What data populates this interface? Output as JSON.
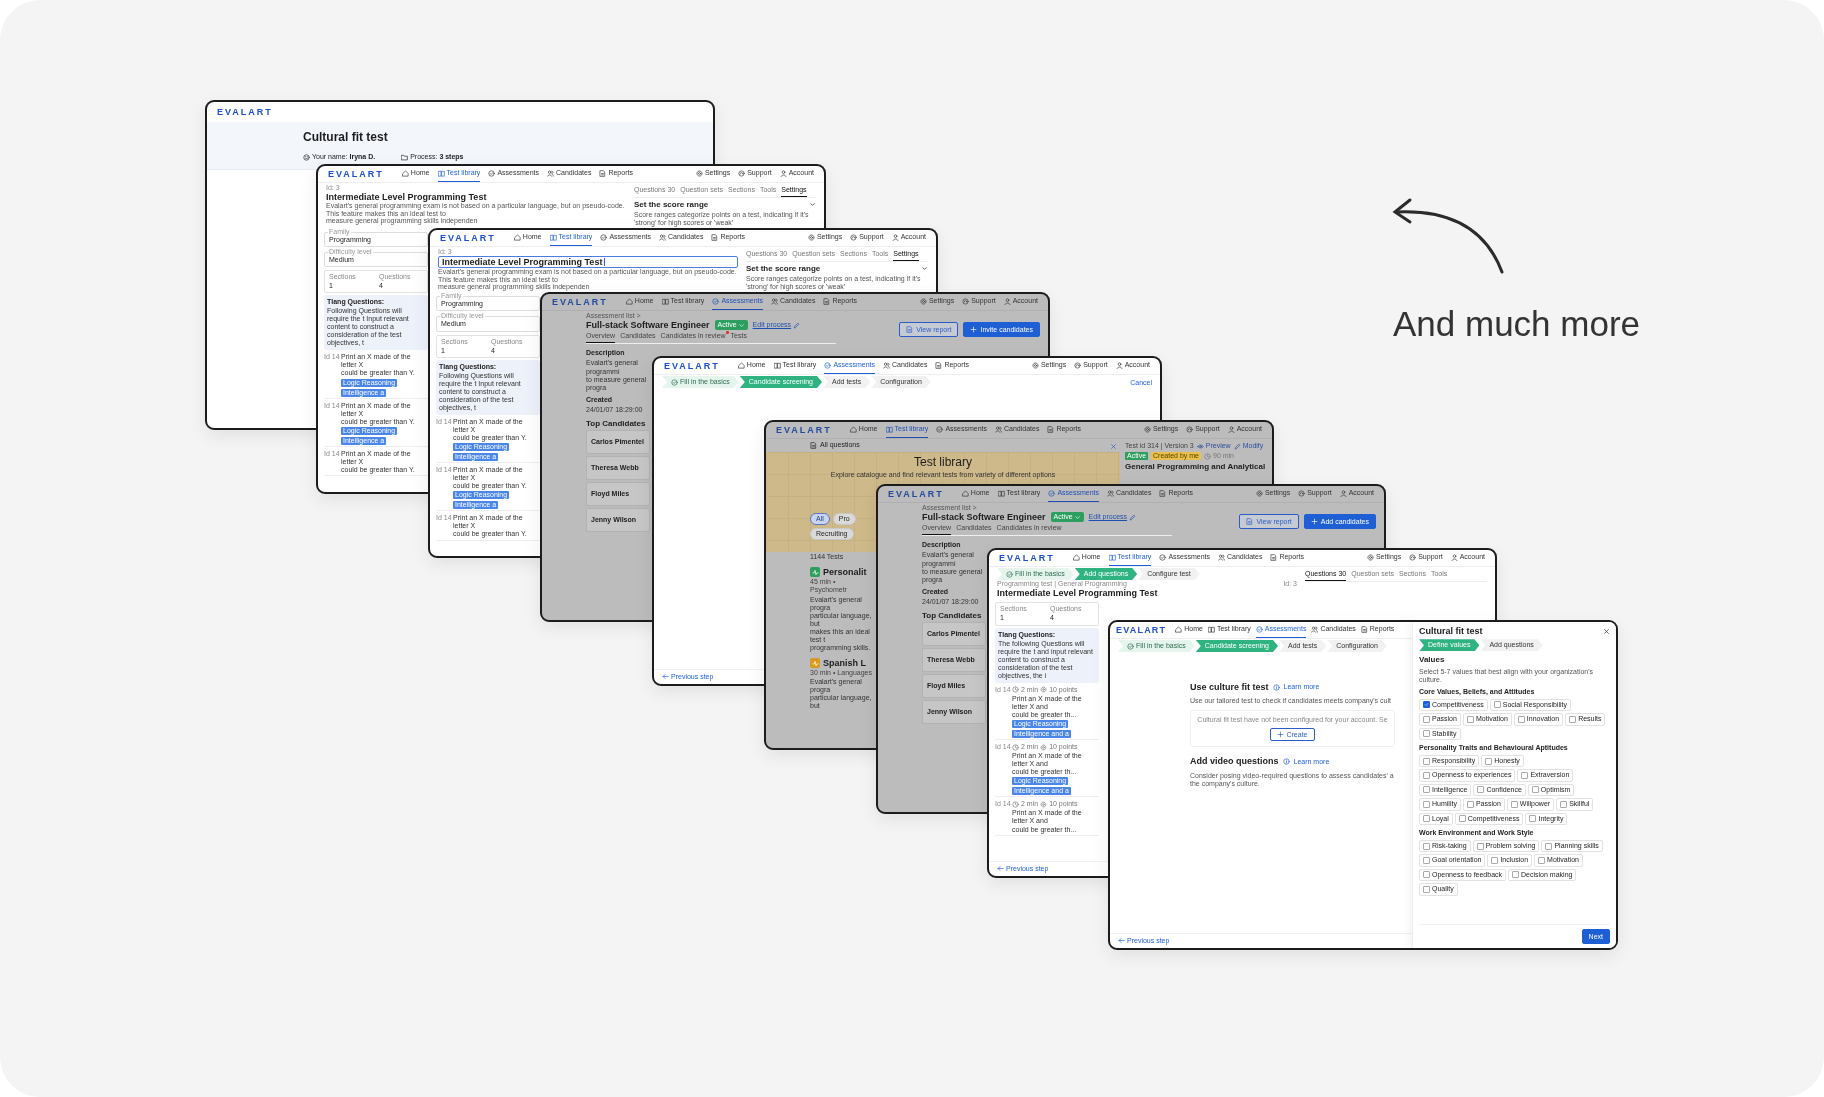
{
  "windows": [
    {
      "kind": "form",
      "dimmed": false,
      "logo": "EVALART",
      "intro": {
        "title": "Cultural fit test",
        "meta": [
          "Your name: **Iryna D.**",
          "Process: **3 steps**"
        ]
      }
    },
    {
      "kind": "editor",
      "dimmed": false,
      "logo": "EVALART",
      "nav": {
        "items": [
          {
            "label": "Home",
            "selected": false
          },
          {
            "label": "Test library",
            "selected": true
          },
          {
            "label": "Assessments",
            "selected": false
          },
          {
            "label": "Candidates",
            "selected": false
          },
          {
            "label": "Reports",
            "selected": false
          }
        ],
        "right": [
          "Settings",
          "Support",
          "Account"
        ]
      },
      "head": [
        {
          "kind": "crumb",
          "text": "Id: 3"
        },
        {
          "kind": "title",
          "text": "Intermediate Level Programming Test"
        },
        {
          "kind": "text",
          "lines": [
            "Evalart's general programming exam is not based on a particular language, but on pseudo-code. This feature makes this an ideal test to",
            "measure general programming skills independen"
          ]
        }
      ],
      "head_right": [
        {
          "kind": "tabs",
          "items": [
            {
              "label": "Questions 30",
              "selected": false
            },
            {
              "label": "Question sets",
              "selected": false
            },
            {
              "label": "Sections",
              "selected": false
            },
            {
              "label": "Tools",
              "selected": false
            },
            {
              "label": "Settings",
              "selected": true
            }
          ]
        },
        {
          "kind": "accordion",
          "text": "Set the score range"
        },
        {
          "kind": "text",
          "lines": [
            "Score ranges categorize points on a test, indicating if it's 'strong' for high scores or 'weak'"
          ]
        }
      ],
      "side": [
        {
          "kind": "field",
          "label": "Family",
          "value": "Programming"
        },
        {
          "kind": "field",
          "label": "Difficulty level",
          "value": "Medium"
        },
        {
          "kind": "stats",
          "items": [
            {
              "label": "Sections",
              "value": "1"
            },
            {
              "label": "Questions",
              "value": "4"
            }
          ]
        },
        {
          "kind": "note",
          "title": "Tlang Questions:",
          "lines": [
            "Following Questions will require the t",
            "Input relevant content to construct a",
            "consideration of the test objectives, t"
          ]
        },
        {
          "kind": "question",
          "id": "Id 14",
          "lines": [
            "Print an X made of the letter X",
            "could be greater than Y."
          ],
          "tags": [
            "Logic Reasoning",
            "Intelligence a"
          ]
        },
        {
          "kind": "question",
          "id": "Id 14",
          "lines": [
            "Print an X made of the letter X",
            "could be greater than Y."
          ],
          "tags": [
            "Logic Reasoning",
            "Intelligence a"
          ]
        },
        {
          "kind": "question",
          "id": "Id 14",
          "lines": [
            "Print an X made of the letter X",
            "could be greater than Y."
          ]
        }
      ]
    },
    {
      "kind": "editor",
      "dimmed": false,
      "logo": "EVALART",
      "nav": {
        "items": [
          {
            "label": "Home",
            "selected": false
          },
          {
            "label": "Test library",
            "selected": true
          },
          {
            "label": "Assessments",
            "selected": false
          },
          {
            "label": "Candidates",
            "selected": false
          },
          {
            "label": "Reports",
            "selected": false
          }
        ],
        "right": [
          "Settings",
          "Support",
          "Account"
        ]
      },
      "head": [
        {
          "kind": "crumb",
          "text": "Id: 3"
        },
        {
          "kind": "title_input",
          "text": "Intermediate Level Programming Test"
        },
        {
          "kind": "text",
          "lines": [
            "Evalart's general programming exam is not based on a particular language, but on pseudo-code. This feature makes this an ideal test to",
            "measure general programming skills independen"
          ]
        }
      ],
      "head_right": [
        {
          "kind": "tabs",
          "items": [
            {
              "label": "Questions 30",
              "selected": false
            },
            {
              "label": "Question sets",
              "selected": false
            },
            {
              "label": "Sections",
              "selected": false
            },
            {
              "label": "Tools",
              "selected": false
            },
            {
              "label": "Settings",
              "selected": true
            }
          ]
        },
        {
          "kind": "accordion",
          "text": "Set the score range"
        },
        {
          "kind": "text",
          "lines": [
            "Score ranges categorize points on a test, indicating if it's 'strong' for high scores or 'weak'"
          ]
        }
      ],
      "side": [
        {
          "kind": "field",
          "label": "Family",
          "value": "Programming"
        },
        {
          "kind": "field",
          "label": "Difficulty level",
          "value": "Medium"
        },
        {
          "kind": "stats",
          "items": [
            {
              "label": "Sections",
              "value": "1"
            },
            {
              "label": "Questions",
              "value": "4"
            }
          ]
        },
        {
          "kind": "note",
          "title": "Tlang Questions:",
          "lines": [
            "Following Questions will require the t",
            "Input relevant content to construct a",
            "consideration of the test objectives, t"
          ]
        },
        {
          "kind": "question",
          "id": "Id 14",
          "lines": [
            "Print an X made of the letter X",
            "could be greater than Y."
          ],
          "tags": [
            "Logic Reasoning",
            "Intelligence a"
          ]
        },
        {
          "kind": "question",
          "id": "Id 14",
          "lines": [
            "Print an X made of the letter X",
            "could be greater than Y."
          ],
          "tags": [
            "Logic Reasoning",
            "Intelligence a"
          ]
        },
        {
          "kind": "question",
          "id": "Id 14",
          "lines": [
            "Print an X made of the letter X",
            "could be greater than Y."
          ]
        }
      ]
    },
    {
      "kind": "assessment",
      "dimmed": true,
      "logo": "EVALART",
      "nav": {
        "items": [
          {
            "label": "Home",
            "selected": false
          },
          {
            "label": "Test library",
            "selected": false
          },
          {
            "label": "Assessments",
            "selected": true
          },
          {
            "label": "Candidates",
            "selected": false
          },
          {
            "label": "Reports",
            "selected": false
          }
        ],
        "right": [
          "Settings",
          "Support",
          "Account"
        ]
      },
      "head": [
        {
          "kind": "crumb",
          "text": "Assessment list >"
        },
        {
          "kind": "job",
          "title": "Full-stack Software Engineer",
          "status": "Active",
          "link": "Edit process"
        },
        {
          "kind": "subtabs",
          "items": [
            {
              "label": "Overview",
              "selected": true,
              "alert": false
            },
            {
              "label": "Candidates",
              "selected": false,
              "alert": false
            },
            {
              "label": "Candidates in review",
              "selected": false,
              "alert": true
            },
            {
              "label": "Tests",
              "selected": false,
              "alert": false
            }
          ]
        }
      ],
      "head_right": [
        {
          "kind": "buttons",
          "items": [
            {
              "kind": "outline",
              "label": "View report"
            },
            {
              "kind": "primary",
              "label": "Invite candidates"
            }
          ]
        }
      ],
      "side": [
        {
          "kind": "label",
          "text": "Description"
        },
        {
          "kind": "text",
          "lines": [
            "Evalart's general programmi",
            "to measure general progra"
          ]
        },
        {
          "kind": "label",
          "text": "Created"
        },
        {
          "kind": "text",
          "lines": [
            "24/01/07 18:29:00"
          ]
        },
        {
          "kind": "heading",
          "text": "Top Candidates"
        },
        {
          "kind": "person",
          "name": "Carlos Pimentel"
        },
        {
          "kind": "person",
          "name": "Theresa Webb"
        },
        {
          "kind": "person",
          "name": "Floyd Miles"
        },
        {
          "kind": "person",
          "name": "Jenny Wilson"
        }
      ]
    },
    {
      "kind": "wizard",
      "dimmed": false,
      "logo": "EVALART",
      "nav": {
        "items": [
          {
            "label": "Home",
            "selected": false
          },
          {
            "label": "Test library",
            "selected": false
          },
          {
            "label": "Assessments",
            "selected": true
          },
          {
            "label": "Candidates",
            "selected": false
          },
          {
            "label": "Reports",
            "selected": false
          }
        ],
        "right": [
          "Settings",
          "Support",
          "Account"
        ]
      },
      "head": [
        {
          "kind": "steps",
          "items": [
            {
              "label": "Fill in the basics",
              "done": true,
              "selected": false
            },
            {
              "label": "Candidate screening",
              "done": false,
              "selected": true
            },
            {
              "label": "Add tests",
              "done": false,
              "selected": false
            },
            {
              "label": "Configuration",
              "done": false,
              "selected": false
            }
          ]
        }
      ],
      "head_right": [
        {
          "kind": "link",
          "text": "Cancel"
        }
      ],
      "foot": [
        {
          "kind": "back_link",
          "text": "Previous step"
        }
      ]
    },
    {
      "kind": "library",
      "dimmed": true,
      "logo": "EVALART",
      "nav": {
        "items": [
          {
            "label": "Home",
            "selected": false
          },
          {
            "label": "Test library",
            "selected": true
          },
          {
            "label": "Assessments",
            "selected": false
          },
          {
            "label": "Candidates",
            "selected": false
          },
          {
            "label": "Reports",
            "selected": false
          }
        ],
        "right": [
          "Settings",
          "Support",
          "Account"
        ]
      },
      "head": [
        {
          "kind": "section_label",
          "text": "All questions"
        }
      ],
      "banner": {
        "title": "Test library",
        "subtitle": "Explore catalogue and find relevant tests from variety of different options",
        "chips": [
          {
            "label": "All",
            "selected": true
          },
          {
            "label": "Pro",
            "selected": false
          },
          {
            "label": "Recruiting",
            "selected": false
          }
        ]
      },
      "panel": {
        "kind": "aside",
        "blocks": [
          {
            "kind": "test_id",
            "text": "Test id 314 | Version 3",
            "links": [
              "Preview",
              "Modify"
            ]
          },
          {
            "kind": "badges",
            "items": [
              {
                "label": "Active",
                "color": "#2e9e5e"
              },
              {
                "label": "Created by me",
                "color": "#e9c04a"
              }
            ],
            "time": "90 min"
          },
          {
            "kind": "heading",
            "text": "General Programming and Analytical"
          }
        ]
      },
      "side": [
        {
          "kind": "text",
          "lines": [
            "1144 Tests"
          ]
        },
        {
          "kind": "test_card",
          "title": "Personalit",
          "color": "#2e9e5e",
          "meta": "45 min • Psychometr",
          "lines": [
            "Evalart's general progra",
            "particular language, but",
            "makes this an ideal test t",
            "programming skills."
          ]
        },
        {
          "kind": "test_card",
          "title": "Spanish L",
          "color": "#d89a1e",
          "meta": "30 min • Languages",
          "lines": [
            "Evalart's general progra",
            "particular language, but"
          ]
        }
      ]
    },
    {
      "kind": "assessment",
      "dimmed": true,
      "logo": "EVALART",
      "nav": {
        "items": [
          {
            "label": "Home",
            "selected": false
          },
          {
            "label": "Test library",
            "selected": false
          },
          {
            "label": "Assessments",
            "selected": true
          },
          {
            "label": "Candidates",
            "selected": false
          },
          {
            "label": "Reports",
            "selected": false
          }
        ],
        "right": [
          "Settings",
          "Support",
          "Account"
        ]
      },
      "head": [
        {
          "kind": "crumb",
          "text": "Assessment list >"
        },
        {
          "kind": "job",
          "title": "Full-stack Software Engineer",
          "status": "Active",
          "link": "Edit process"
        },
        {
          "kind": "subtabs",
          "items": [
            {
              "label": "Overview",
              "selected": true,
              "alert": false
            },
            {
              "label": "Candidates",
              "selected": false,
              "alert": false
            },
            {
              "label": "Candidates in review",
              "selected": false,
              "alert": false
            }
          ]
        }
      ],
      "head_right": [
        {
          "kind": "buttons",
          "items": [
            {
              "kind": "outline",
              "label": "View report"
            },
            {
              "kind": "primary",
              "label": "Add candidates"
            }
          ]
        }
      ],
      "side": [
        {
          "kind": "label",
          "text": "Description"
        },
        {
          "kind": "text",
          "lines": [
            "Evalart's general programmi",
            "to measure general progra"
          ]
        },
        {
          "kind": "label",
          "text": "Created"
        },
        {
          "kind": "text",
          "lines": [
            "24/01/07 18:29:00"
          ]
        },
        {
          "kind": "heading",
          "text": "Top Candidates"
        },
        {
          "kind": "person",
          "name": "Carlos Pimentel"
        },
        {
          "kind": "person",
          "name": "Theresa Webb"
        },
        {
          "kind": "person",
          "name": "Floyd Miles"
        },
        {
          "kind": "person",
          "name": "Jenny Wilson"
        }
      ]
    },
    {
      "kind": "editor",
      "dimmed": false,
      "logo": "EVALART",
      "nav": {
        "items": [
          {
            "label": "Home",
            "selected": false
          },
          {
            "label": "Test library",
            "selected": true
          },
          {
            "label": "Assessments",
            "selected": false
          },
          {
            "label": "Candidates",
            "selected": false
          },
          {
            "label": "Reports",
            "selected": false
          }
        ],
        "right": [
          "Settings",
          "Support",
          "Account"
        ]
      },
      "head": [
        {
          "kind": "steps",
          "items": [
            {
              "label": "Fill in the basics",
              "done": true,
              "selected": false
            },
            {
              "label": "Add questions",
              "done": false,
              "selected": true
            },
            {
              "label": "Configure test",
              "done": false,
              "selected": false
            }
          ]
        },
        {
          "kind": "crumb",
          "text": "Programming test | General Programming",
          "aside": "Id: 3"
        },
        {
          "kind": "title",
          "text": "Intermediate Level Programming Test"
        }
      ],
      "head_right": [
        {
          "kind": "tabs",
          "items": [
            {
              "label": "Questions 30",
              "selected": true
            },
            {
              "label": "Question sets",
              "selected": false
            },
            {
              "label": "Sections",
              "selected": false
            },
            {
              "label": "Tools",
              "selected": false
            }
          ]
        }
      ],
      "side": [
        {
          "kind": "stats",
          "items": [
            {
              "label": "Sections",
              "value": "1"
            },
            {
              "label": "Questions",
              "value": "4"
            }
          ]
        },
        {
          "kind": "note",
          "title": "Tlang Questions:",
          "lines": [
            "The following Questions will require the t",
            "and input relevant content to construct a",
            "consideration of the test objectives, the i"
          ]
        },
        {
          "kind": "question",
          "id": "Id 14",
          "time": "2 min",
          "points": "10 points",
          "lines": [
            "Print an X made of the letter X and",
            "could be greater th..."
          ],
          "tags": [
            "Logic Reasoning",
            "Intelligence and a"
          ]
        },
        {
          "kind": "question",
          "id": "Id 14",
          "time": "2 min",
          "points": "10 points",
          "lines": [
            "Print an X made of the letter X and",
            "could be greater th..."
          ],
          "tags": [
            "Logic Reasoning",
            "Intelligence and a"
          ]
        },
        {
          "kind": "question",
          "id": "Id 14",
          "time": "2 min",
          "points": "10 points",
          "lines": [
            "Print an X made of the letter X and",
            "could be greater th..."
          ]
        }
      ],
      "foot": [
        {
          "kind": "back_link",
          "text": "Previous step"
        }
      ]
    },
    {
      "kind": "culture",
      "dimmed": false,
      "logo": "EVALART",
      "nav": {
        "items": [
          {
            "label": "Home",
            "selected": false
          },
          {
            "label": "Test library",
            "selected": false
          },
          {
            "label": "Assessments",
            "selected": true
          },
          {
            "label": "Candidates",
            "selected": false
          },
          {
            "label": "Reports",
            "selected": false
          }
        ]
      },
      "head": [
        {
          "kind": "steps",
          "items": [
            {
              "label": "Fill in the basics",
              "done": true,
              "selected": false
            },
            {
              "label": "Candidate screening",
              "done": false,
              "selected": true
            },
            {
              "label": "Add tests",
              "done": false,
              "selected": false
            },
            {
              "label": "Configuration",
              "done": false,
              "selected": false
            }
          ]
        }
      ],
      "side": [
        {
          "kind": "section_intro",
          "title": "Use culture fit test",
          "link": "Learn more"
        },
        {
          "kind": "text",
          "lines": [
            "Use our tailored test to check if candidates meets company's cult"
          ]
        },
        {
          "kind": "empty_box",
          "text": "Cultural fit test have not been configured for your account. Se",
          "button": "Create"
        },
        {
          "kind": "section_intro",
          "title": "Add video questions",
          "link": "Learn more"
        },
        {
          "kind": "text",
          "lines": [
            "Consider posing video-required questions to assess candidates' a",
            "the company's culture."
          ]
        }
      ],
      "foot": [
        {
          "kind": "back_link",
          "text": "Previous step"
        }
      ],
      "panel": {
        "kind": "drawer",
        "blocks": [
          {
            "kind": "drawer_title",
            "text": "Cultural fit test"
          },
          {
            "kind": "steps",
            "items": [
              {
                "label": "Define values",
                "done": false,
                "selected": true
              },
              {
                "label": "Add questions",
                "done": false,
                "selected": false
              }
            ]
          },
          {
            "kind": "heading",
            "text": "Values"
          },
          {
            "kind": "text",
            "lines": [
              "Select 5-7 values that best align with your organization's culture."
            ]
          },
          {
            "kind": "group",
            "text": "Core Values, Beliefs, and Attitudes"
          },
          {
            "kind": "checks",
            "items": [
              {
                "label": "Competitiveness",
                "checked": true
              },
              {
                "label": "Social Responsibility",
                "checked": false
              },
              {
                "label": "Passion",
                "checked": false
              },
              {
                "label": "Motivation",
                "checked": false
              },
              {
                "label": "Innovation",
                "checked": false
              },
              {
                "label": "Results",
                "checked": false
              },
              {
                "label": "Stability",
                "checked": false
              }
            ]
          },
          {
            "kind": "group",
            "text": "Personality Traits and Behavioural Aptitudes"
          },
          {
            "kind": "checks",
            "items": [
              {
                "label": "Responsibility",
                "checked": false
              },
              {
                "label": "Honesty",
                "checked": false
              },
              {
                "label": "Openness to experiences",
                "checked": false
              },
              {
                "label": "Extraversion",
                "checked": false
              },
              {
                "label": "Intelligence",
                "checked": false
              },
              {
                "label": "Confidence",
                "checked": false
              },
              {
                "label": "Optimism",
                "checked": false
              },
              {
                "label": "Humility",
                "checked": false
              },
              {
                "label": "Passion",
                "checked": false
              },
              {
                "label": "Willpower",
                "checked": false
              },
              {
                "label": "Skillful",
                "checked": false
              },
              {
                "label": "Loyal",
                "checked": false
              },
              {
                "label": "Competitiveness",
                "checked": false
              },
              {
                "label": "Integrity",
                "checked": false
              }
            ]
          },
          {
            "kind": "group",
            "text": "Work Environment and Work Style"
          },
          {
            "kind": "checks",
            "items": [
              {
                "label": "Risk-taking",
                "checked": false
              },
              {
                "label": "Problem solving",
                "checked": false
              },
              {
                "label": "Planning skills",
                "checked": false
              },
              {
                "label": "Goal orientation",
                "checked": false
              },
              {
                "label": "Inclusion",
                "checked": false
              },
              {
                "label": "Motivation",
                "checked": false
              },
              {
                "label": "Openness to feedback",
                "checked": false
              },
              {
                "label": "Decision making",
                "checked": false
              },
              {
                "label": "Quality",
                "checked": false
              }
            ]
          }
        ],
        "button": "Next"
      }
    }
  ],
  "tagline": "And much more"
}
